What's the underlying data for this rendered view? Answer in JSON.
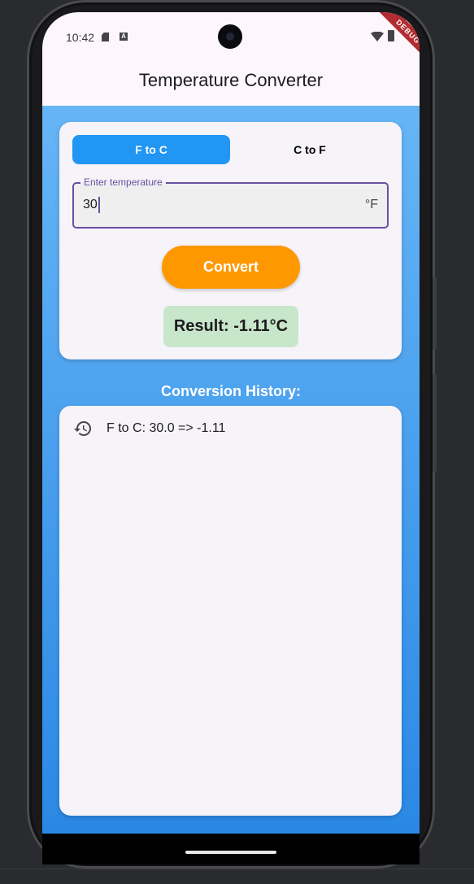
{
  "status_bar": {
    "time": "10:42",
    "debug_label": "DEBUG"
  },
  "app_bar": {
    "title": "Temperature Converter"
  },
  "converter": {
    "mode_options": [
      "F to C",
      "C to F"
    ],
    "selected_mode": "F to C",
    "input_label": "Enter temperature",
    "input_value": "30",
    "input_suffix": "°F",
    "convert_label": "Convert",
    "result_text": "Result: -1.11°C"
  },
  "history": {
    "title": "Conversion History:",
    "items": [
      {
        "icon": "history-icon",
        "text": "F to C: 30.0 => -1.11"
      }
    ]
  },
  "colors": {
    "accent_blue": "#2196f3",
    "convert_orange": "#fe9800",
    "result_green": "#c8e6c9",
    "focus_purple": "#6750a4"
  }
}
